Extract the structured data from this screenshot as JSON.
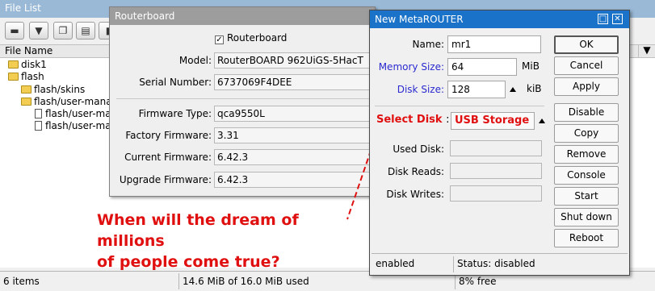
{
  "file_list": {
    "title": "File List",
    "column_header": "File Name",
    "items": [
      {
        "name": "disk1",
        "type": "folder"
      },
      {
        "name": "flash",
        "type": "folder"
      },
      {
        "name": "flash/skins",
        "type": "folder"
      },
      {
        "name": "flash/user-mana",
        "type": "folder"
      },
      {
        "name": "flash/user-ma",
        "type": "file"
      },
      {
        "name": "flash/user-ma",
        "type": "file"
      }
    ],
    "status": {
      "count": "6 items",
      "usage": "14.6 MiB of 16.0 MiB used",
      "free": "8% free"
    }
  },
  "routerboard": {
    "title": "Routerboard",
    "routerboard_label": "Routerboard",
    "model_label": "Model:",
    "model": "RouterBOARD 962UiGS-5HacT",
    "serial_label": "Serial Number:",
    "serial": "6737069F4DEE",
    "firmware_type_label": "Firmware Type:",
    "firmware_type": "qca9550L",
    "factory_label": "Factory Firmware:",
    "factory": "3.31",
    "current_label": "Current Firmware:",
    "current": "6.42.3",
    "upgrade_label": "Upgrade Firmware:",
    "upgrade": "6.42.3"
  },
  "metarouter": {
    "title": "New MetaROUTER",
    "name_label": "Name:",
    "name_value": "mr1",
    "memory_label": "Memory Size:",
    "memory_value": "64",
    "memory_unit": "MiB",
    "disk_label": "Disk Size:",
    "disk_value": "128",
    "disk_unit": "kiB",
    "select_disk_label": "Select Disk",
    "select_disk_colon": ":",
    "select_disk_value": "USB Storage",
    "used_disk_label": "Used Disk:",
    "disk_reads_label": "Disk Reads:",
    "disk_writes_label": "Disk Writes:",
    "buttons": [
      "OK",
      "Cancel",
      "Apply",
      "Disable",
      "Copy",
      "Remove",
      "Console",
      "Start",
      "Shut down",
      "Reboot"
    ],
    "status_left": "enabled",
    "status_right": "Status: disabled"
  },
  "caption": {
    "line1": "When will the dream of millions",
    "line2": "of people come true?"
  },
  "colors": {
    "accent": "#1a73c9",
    "highlight": "#e01010",
    "label_blue": "#2a2ad0"
  }
}
